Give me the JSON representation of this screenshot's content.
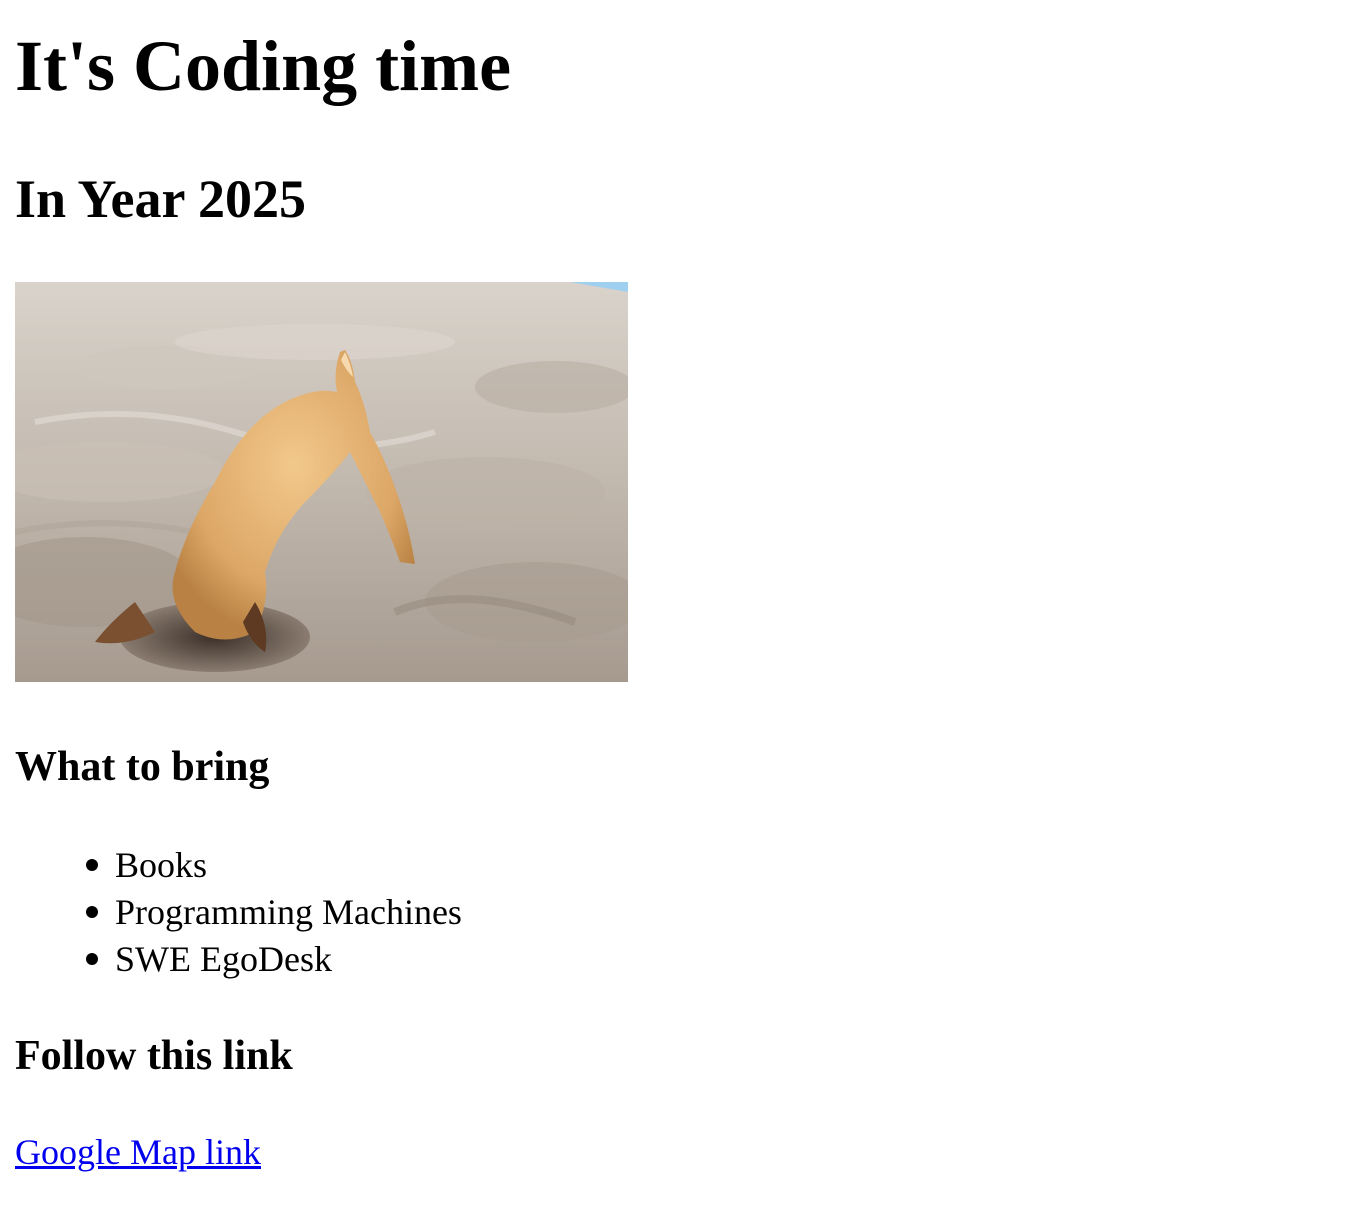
{
  "header": {
    "title": "It's Coding time",
    "subtitle": "In Year 2025"
  },
  "photo": {
    "icon": "dog-digging-in-sand-image"
  },
  "bring_section": {
    "heading": "What to bring",
    "items": [
      {
        "label": "Books"
      },
      {
        "label": "Programming Machines"
      },
      {
        "label": "SWE EgoDesk"
      }
    ]
  },
  "link_section": {
    "heading": "Follow this link",
    "link_text": "Google Map link"
  },
  "colors": {
    "link": "#0000ee",
    "text": "#000000",
    "background": "#ffffff"
  }
}
